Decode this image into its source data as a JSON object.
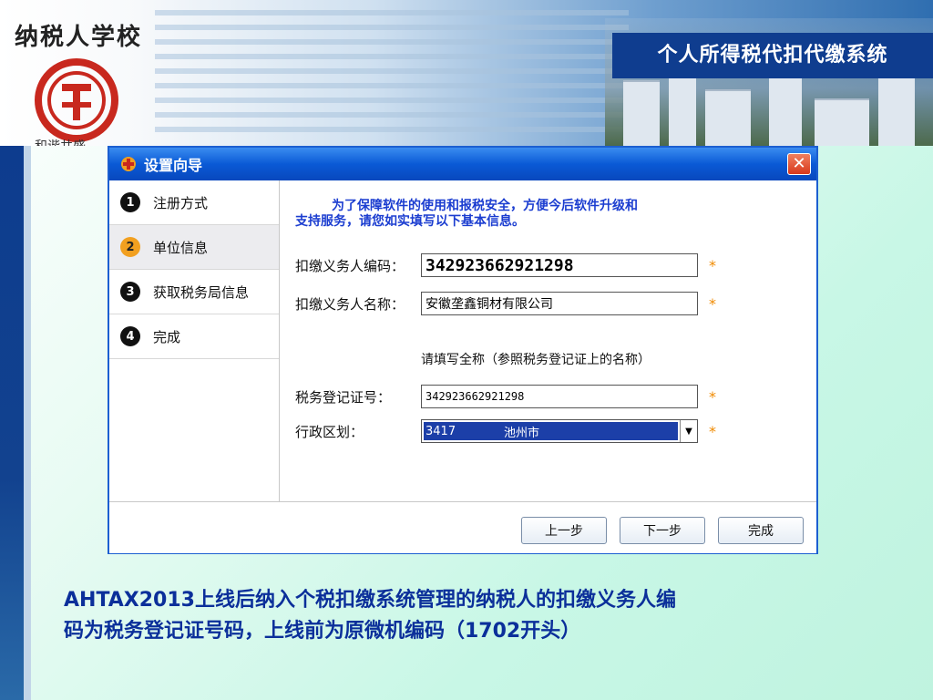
{
  "header": {
    "school_name": "纳税人学校",
    "slogan": "和谐共盛",
    "system_title": "个人所得税代扣代缴系统"
  },
  "dialog": {
    "title": "设置向导",
    "steps": [
      {
        "num": "1",
        "label": "注册方式"
      },
      {
        "num": "2",
        "label": "单位信息"
      },
      {
        "num": "3",
        "label": "获取税务局信息"
      },
      {
        "num": "4",
        "label": "完成"
      }
    ],
    "intro_line1": "为了保障软件的使用和报税安全，方便今后软件升级和",
    "intro_line2": "支持服务，请您如实填写以下基本信息。",
    "fields": {
      "agent_code": {
        "label": "扣缴义务人编码：",
        "value": "342923662921298"
      },
      "agent_name": {
        "label": "扣缴义务人名称：",
        "value": "安徽垄鑫铜材有限公司"
      },
      "name_hint": "请填写全称（参照税务登记证上的名称）",
      "tax_reg": {
        "label": "税务登记证号：",
        "value": "342923662921298"
      },
      "region": {
        "label": "行政区划：",
        "code": "3417",
        "name": "池州市"
      }
    },
    "required_mark": "*",
    "buttons": {
      "prev": "上一步",
      "next": "下一步",
      "finish": "完成"
    },
    "close_symbol": "✕"
  },
  "caption": {
    "line1": "AHTAX2013上线后纳入个税扣缴系统管理的纳税人的扣缴义务人编",
    "line2": "码为税务登记证号码，上线前为原微机编码（1702开头）"
  },
  "colors": {
    "accent": "#0f3d8f",
    "titlebar": "#0a5ad6",
    "caption": "#0b2f9a",
    "required": "#f08a00"
  }
}
